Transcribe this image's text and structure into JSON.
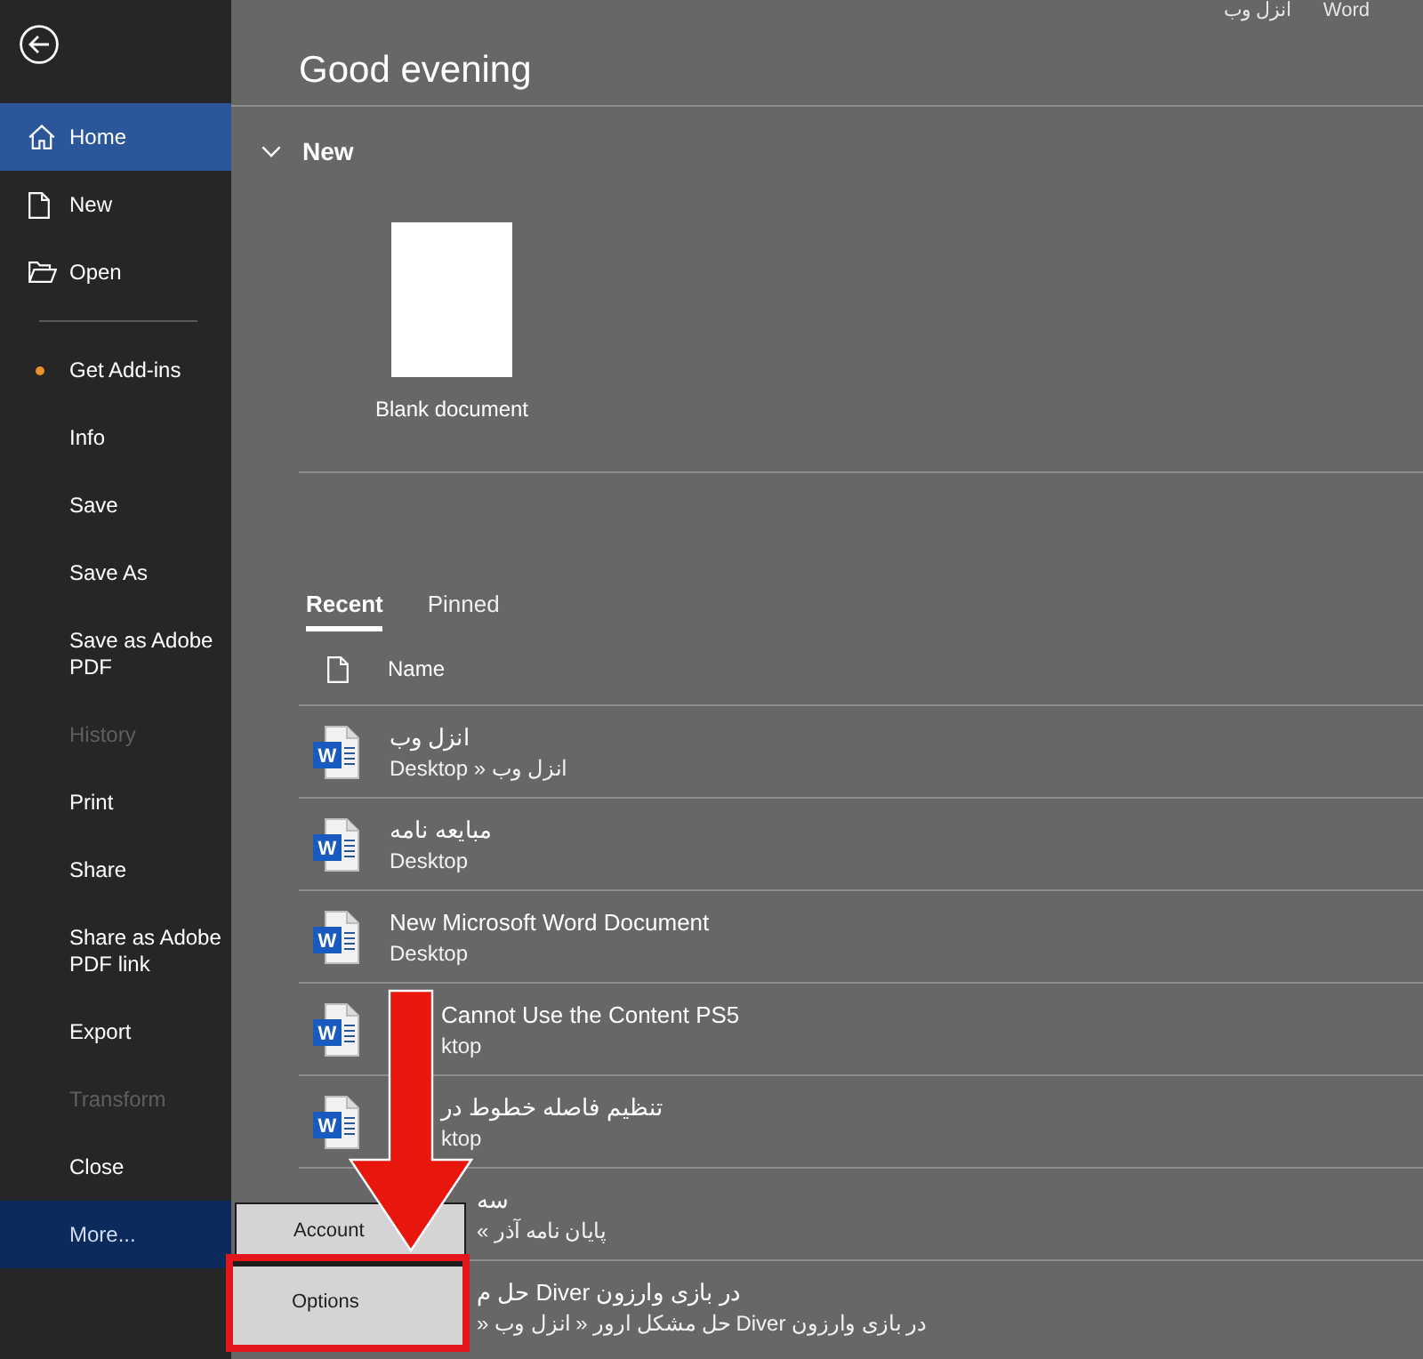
{
  "title_bar": {
    "document": "انزل وب",
    "app": "Word"
  },
  "sidebar": {
    "items": [
      {
        "kind": "home",
        "label": "Home",
        "selected": true,
        "expanded": false,
        "disabled": false,
        "dot": false
      },
      {
        "kind": "new",
        "label": "New",
        "selected": false,
        "expanded": false,
        "disabled": false,
        "dot": false
      },
      {
        "kind": "open",
        "label": "Open",
        "selected": false,
        "expanded": false,
        "disabled": false,
        "dot": false
      },
      {
        "kind": "separator"
      },
      {
        "kind": "command",
        "label": "Get Add-ins",
        "selected": false,
        "expanded": false,
        "disabled": false,
        "dot": true
      },
      {
        "kind": "command",
        "label": "Info",
        "selected": false,
        "expanded": false,
        "disabled": false,
        "dot": false
      },
      {
        "kind": "command",
        "label": "Save",
        "selected": false,
        "expanded": false,
        "disabled": false,
        "dot": false
      },
      {
        "kind": "command",
        "label": "Save As",
        "selected": false,
        "expanded": false,
        "disabled": false,
        "dot": false
      },
      {
        "kind": "command",
        "label": "Save as Adobe PDF",
        "selected": false,
        "expanded": false,
        "disabled": false,
        "dot": false
      },
      {
        "kind": "command",
        "label": "History",
        "selected": false,
        "expanded": false,
        "disabled": true,
        "dot": false
      },
      {
        "kind": "command",
        "label": "Print",
        "selected": false,
        "expanded": false,
        "disabled": false,
        "dot": false
      },
      {
        "kind": "command",
        "label": "Share",
        "selected": false,
        "expanded": false,
        "disabled": false,
        "dot": false
      },
      {
        "kind": "command",
        "label": "Share as Adobe PDF link",
        "selected": false,
        "expanded": false,
        "disabled": false,
        "dot": false
      },
      {
        "kind": "command",
        "label": "Export",
        "selected": false,
        "expanded": false,
        "disabled": false,
        "dot": false
      },
      {
        "kind": "command",
        "label": "Transform",
        "selected": false,
        "expanded": false,
        "disabled": true,
        "dot": false
      },
      {
        "kind": "command",
        "label": "Close",
        "selected": false,
        "expanded": false,
        "disabled": false,
        "dot": false
      },
      {
        "kind": "command",
        "label": "More...",
        "selected": false,
        "expanded": true,
        "disabled": false,
        "dot": false
      }
    ]
  },
  "greeting": "Good evening",
  "new_section": {
    "title": "New",
    "expanded": true,
    "templates": [
      {
        "label": "Blank document"
      }
    ]
  },
  "file_tabs": [
    {
      "label": "Recent",
      "selected": true
    },
    {
      "label": "Pinned",
      "selected": false
    }
  ],
  "file_list": {
    "column": "Name",
    "rows": [
      {
        "kind": "plain",
        "icon_letter": "W",
        "title": "انزل وب",
        "subtitle": "Desktop » انزل وب"
      },
      {
        "kind": "plain",
        "icon_letter": "W",
        "title": "مبایعه نامه",
        "subtitle": "Desktop"
      },
      {
        "kind": "plain",
        "icon_letter": "W",
        "title": "New Microsoft Word Document",
        "subtitle": "Desktop"
      },
      {
        "kind": "arrow",
        "icon_letter": "W",
        "title": "Cannot Use the Content PS5",
        "subtitle": "ktop"
      },
      {
        "kind": "arrow",
        "icon_letter": "W",
        "title": "تنظیم فاصله خطوط در",
        "subtitle": "ktop"
      },
      {
        "kind": "menu",
        "title": "سه",
        "subtitle": "پایان نامه آذر »"
      },
      {
        "kind": "menu",
        "title": "در بازی وارزون Diver حل م",
        "subtitle": "در بازی وارزون Diver حل مشکل ارور « انزل وب «"
      }
    ]
  },
  "more_menu": {
    "items": [
      {
        "label": "Account",
        "highlighted": false
      },
      {
        "label": "Options",
        "highlighted": true
      }
    ]
  }
}
